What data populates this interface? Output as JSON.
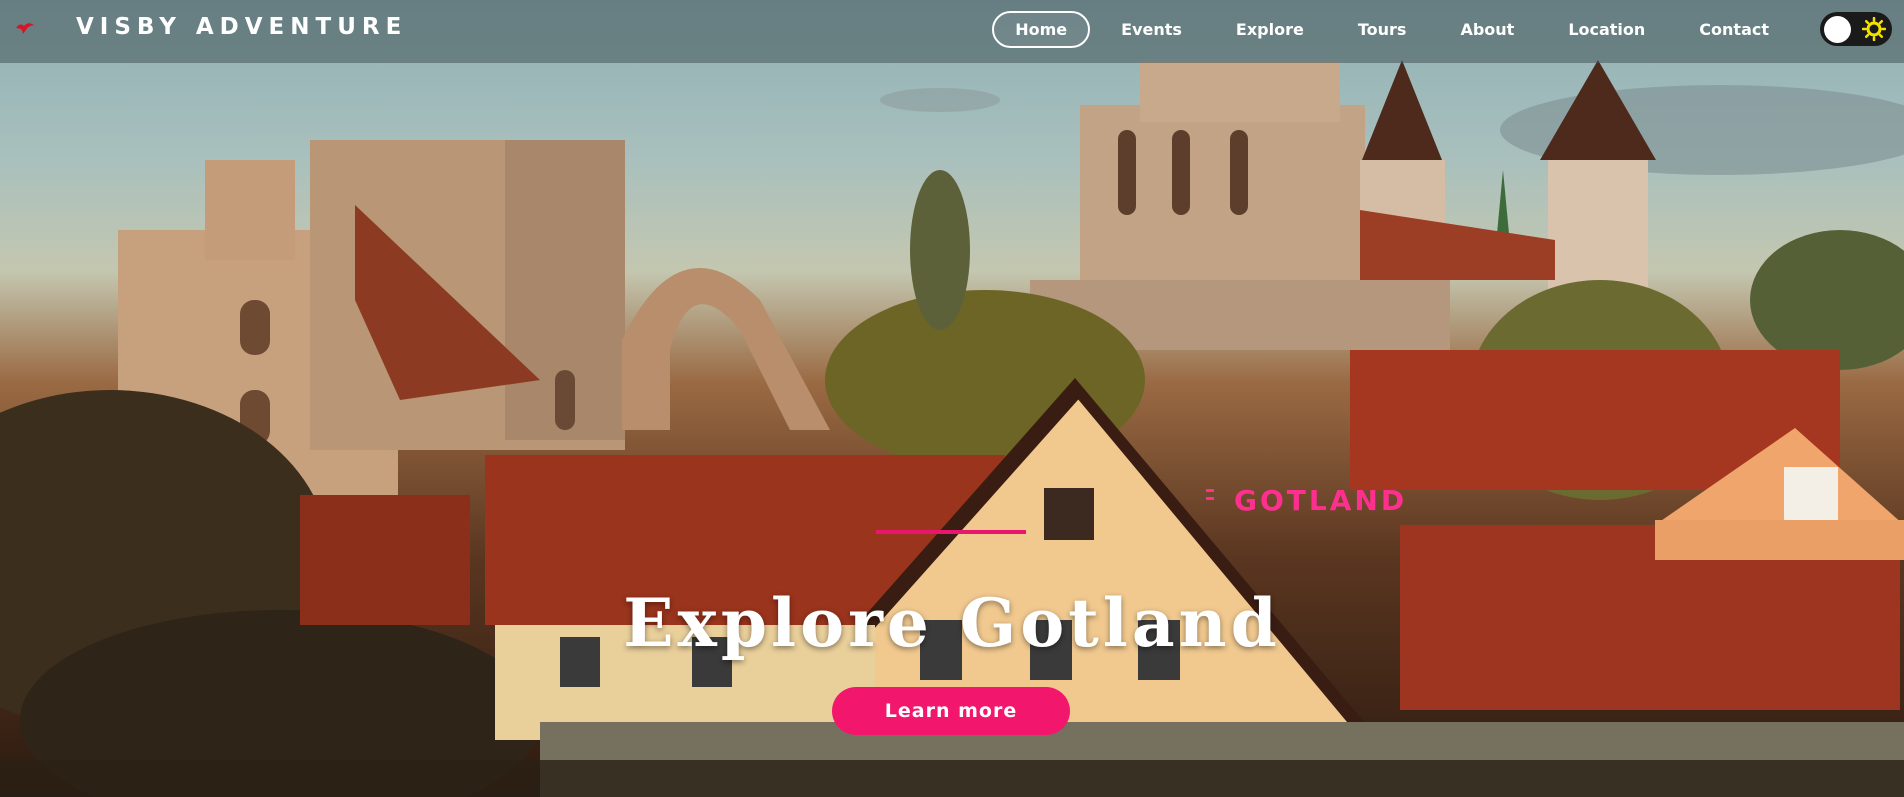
{
  "brand": {
    "name": "VISBY ADVENTURE",
    "logo_icon": "red-gull-logo-icon"
  },
  "nav": {
    "items": [
      {
        "label": "Home",
        "active": true
      },
      {
        "label": "Events",
        "active": false
      },
      {
        "label": "Explore",
        "active": false
      },
      {
        "label": "Tours",
        "active": false
      },
      {
        "label": "About",
        "active": false
      },
      {
        "label": "Location",
        "active": false
      },
      {
        "label": "Contact",
        "active": false
      }
    ],
    "theme_toggle": {
      "state": "light",
      "icon": "sun-icon"
    }
  },
  "hero": {
    "eyebrow": "GOTLAND",
    "title": "Explore Gotland",
    "cta_label": "Learn more"
  },
  "colors": {
    "accent": "#f2166d",
    "eyebrow": "#ff2f8f",
    "nav_bg": "#46555a",
    "sun": "#f5e100"
  }
}
